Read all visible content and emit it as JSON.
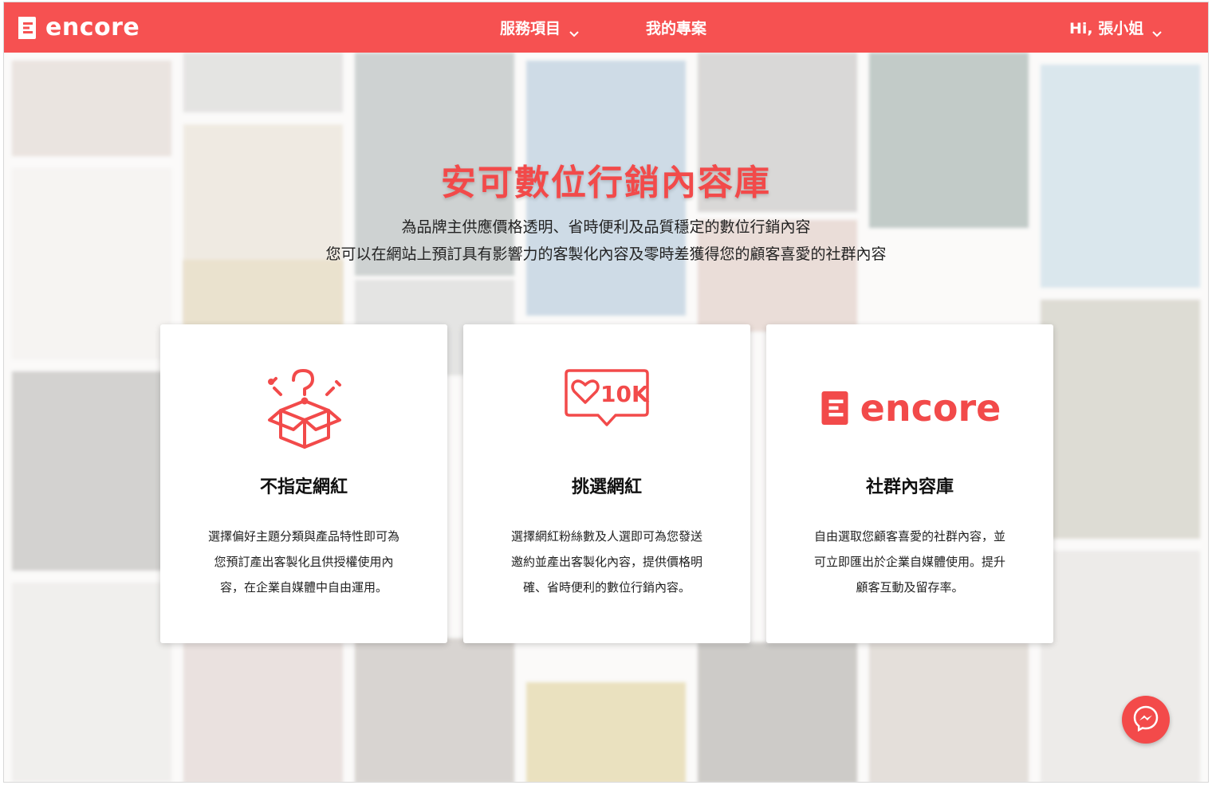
{
  "header": {
    "brand": "encore",
    "nav": [
      {
        "label": "服務項目",
        "has_dropdown": true
      },
      {
        "label": "我的專案",
        "has_dropdown": false
      }
    ],
    "user_greeting": "Hi, 張小姐"
  },
  "hero": {
    "title": "安可數位行銷內容庫",
    "subtitle_line1": "為品牌主供應價格透明、省時便利及品質穩定的數位行銷內容",
    "subtitle_line2": "您可以在網站上預訂具有影響力的客製化內容及零時差獲得您的顧客喜愛的社群內容"
  },
  "cards": [
    {
      "icon": "mystery-box-icon",
      "title": "不指定網紅",
      "description": "選擇偏好主題分類與產品特性即可為您預訂產出客製化且供授權使用內容，在企業自媒體中自由運用。"
    },
    {
      "icon": "likes-10k-icon",
      "icon_text": "10K",
      "title": "挑選網紅",
      "description": "選擇網紅粉絲數及人選即可為您發送邀約並產出客製化內容，提供價格明確、省時便利的數位行銷內容。"
    },
    {
      "icon": "encore-logo-icon",
      "icon_text": "encore",
      "title": "社群內容庫",
      "description": "自由選取您顧客喜愛的社群內容，並可立即匯出於企業自媒體使用。提升顧客互動及留存率。"
    }
  ],
  "colors": {
    "brand": "#f65151",
    "accent_icon": "#f24a4a",
    "text": "#222222"
  },
  "floating": {
    "messenger_icon": "messenger-icon"
  }
}
